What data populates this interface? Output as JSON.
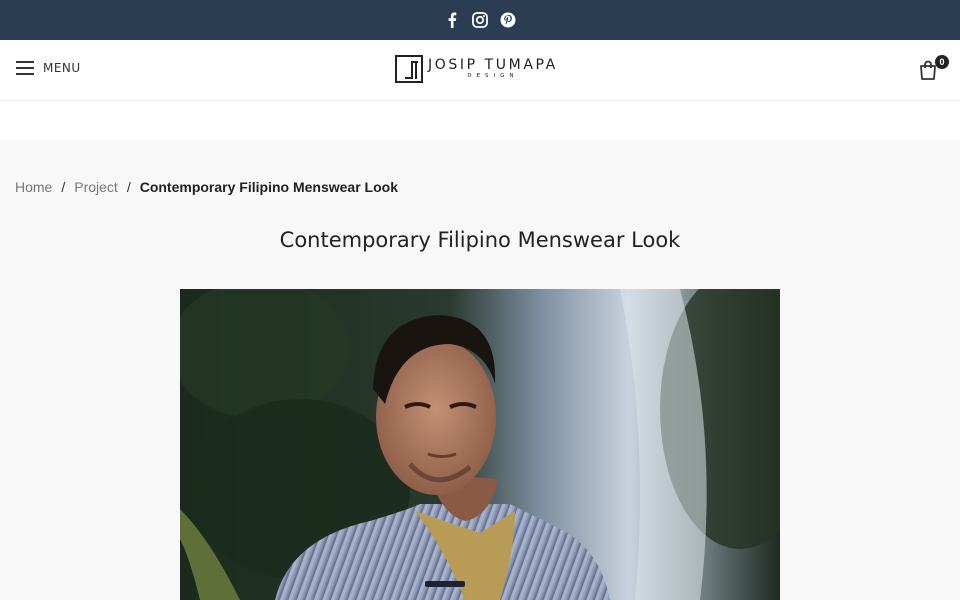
{
  "topbar": {
    "social": [
      {
        "name": "facebook-icon"
      },
      {
        "name": "instagram-icon"
      },
      {
        "name": "pinterest-icon"
      }
    ]
  },
  "header": {
    "menu_label": "MENU",
    "logo_name": "JOSIP TUMAPA",
    "logo_sub": "DESIGN",
    "cart_count": "0"
  },
  "breadcrumb": {
    "home": "Home",
    "project": "Project",
    "current": "Contemporary Filipino Menswear Look"
  },
  "page": {
    "title": "Contemporary Filipino Menswear Look"
  },
  "colors": {
    "topbar": "#2b3d52",
    "page_bg": "#f8f8f8"
  }
}
